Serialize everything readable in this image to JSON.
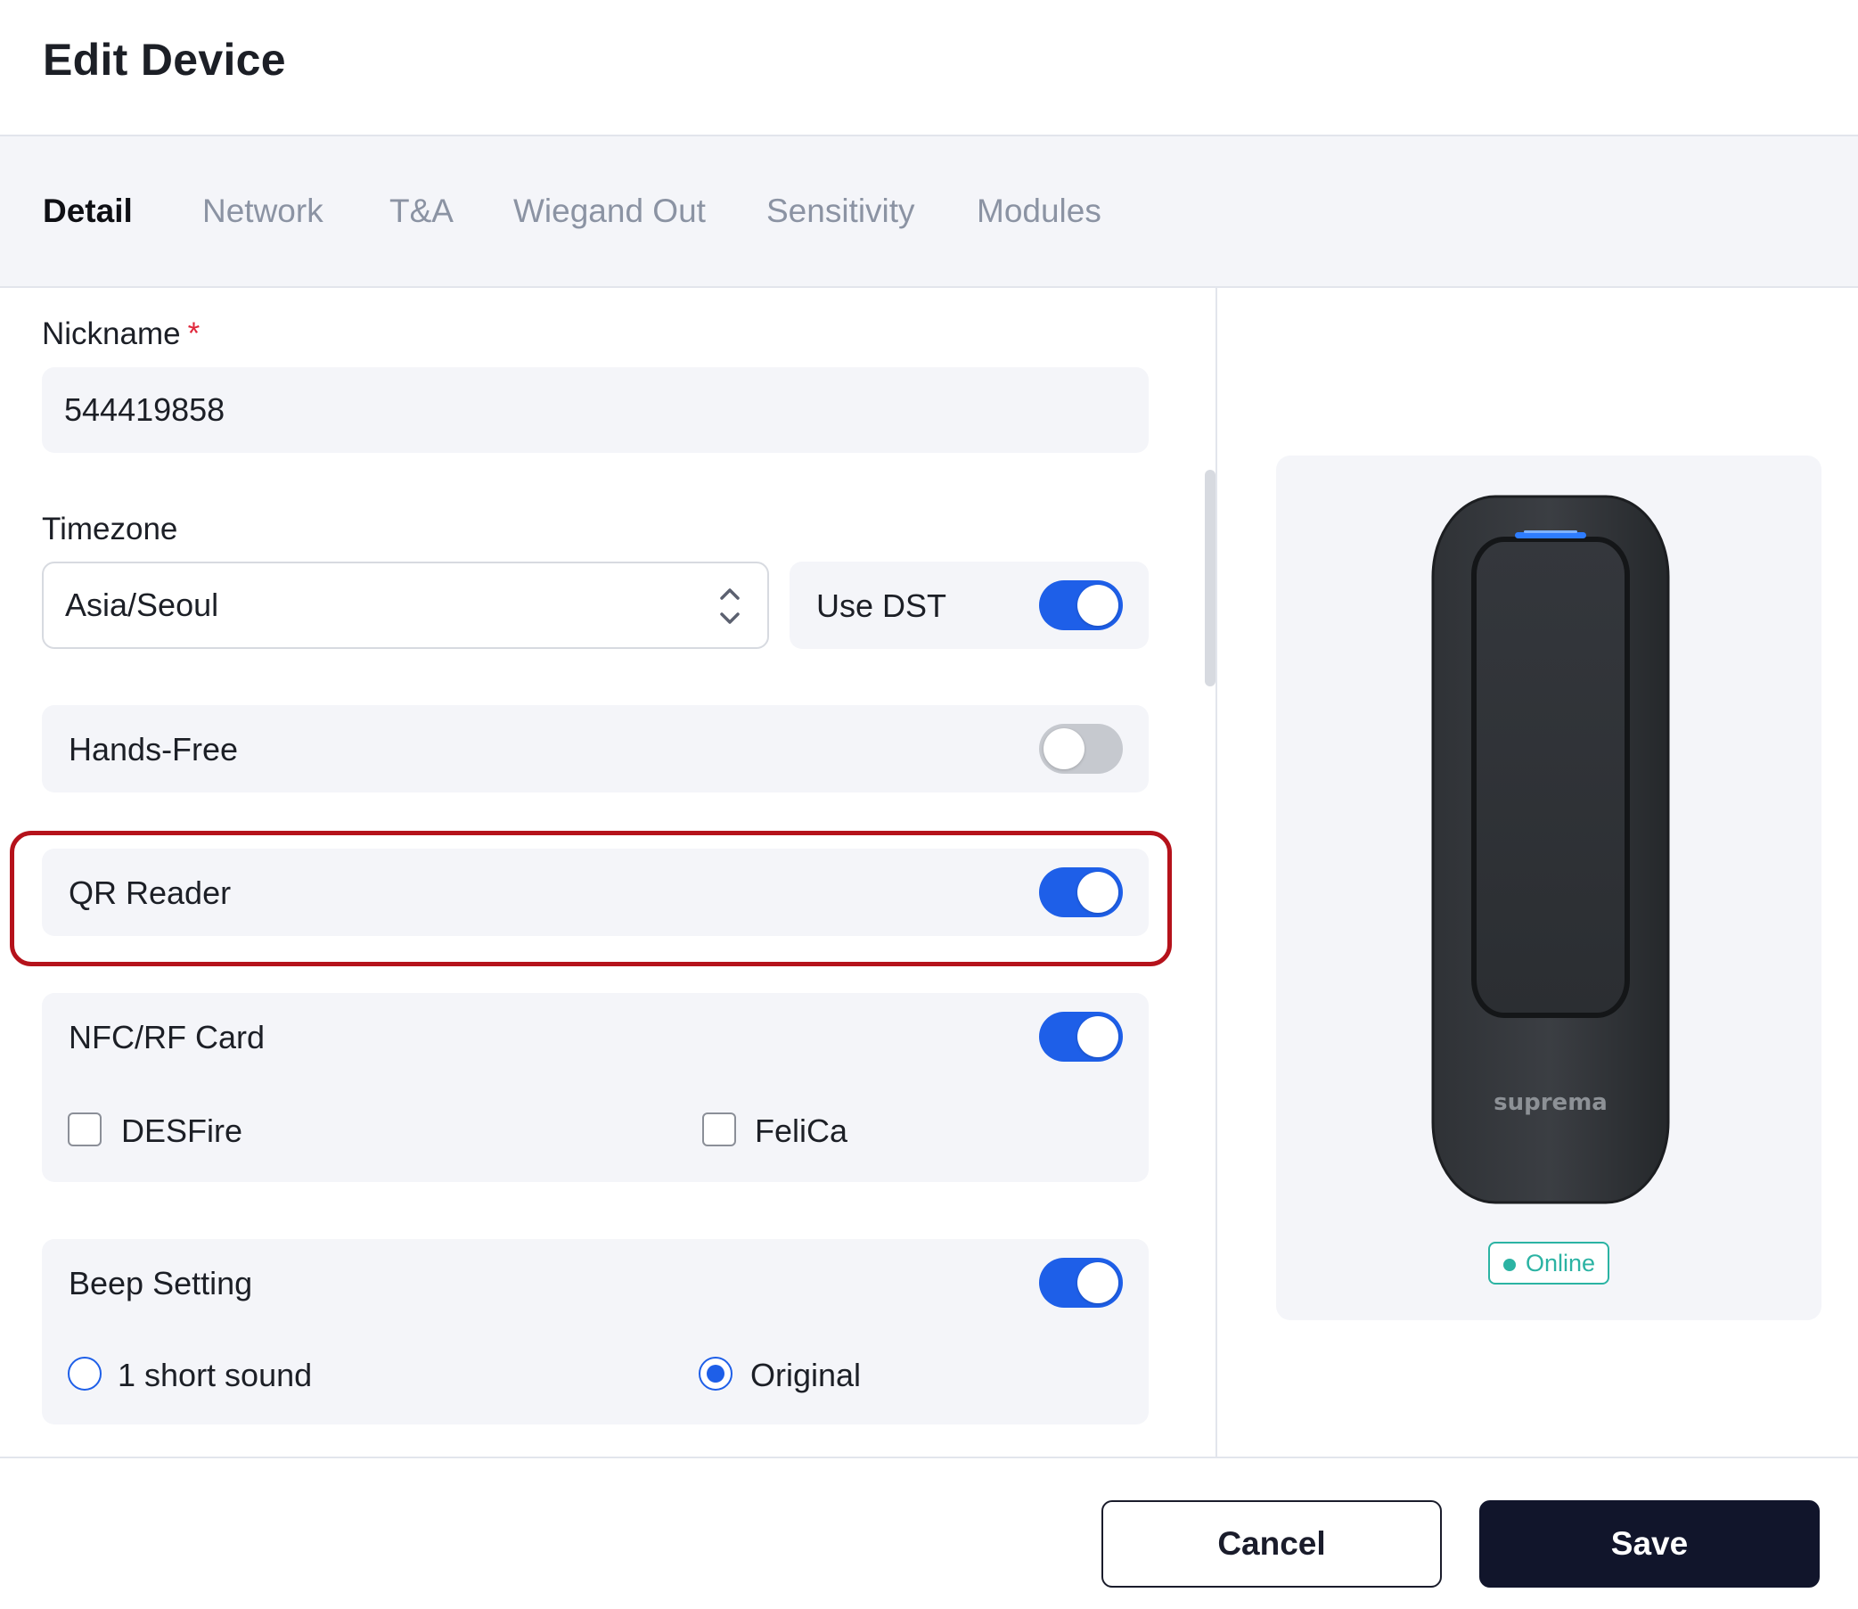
{
  "dialog": {
    "title": "Edit Device"
  },
  "tabs": [
    {
      "label": "Detail",
      "active": true
    },
    {
      "label": "Network",
      "active": false
    },
    {
      "label": "T&A",
      "active": false
    },
    {
      "label": "Wiegand Out",
      "active": false
    },
    {
      "label": "Sensitivity",
      "active": false
    },
    {
      "label": "Modules",
      "active": false
    }
  ],
  "nickname": {
    "label": "Nickname",
    "required_mark": "*",
    "value": "544419858"
  },
  "timezone": {
    "label": "Timezone",
    "value": "Asia/Seoul",
    "icon": "chevron-updown-icon"
  },
  "use_dst": {
    "label": "Use DST",
    "on": true
  },
  "hands_free": {
    "label": "Hands-Free",
    "on": false
  },
  "qr_reader": {
    "label": "QR Reader",
    "on": true,
    "highlighted": true
  },
  "nfc": {
    "label": "NFC/RF Card",
    "on": true,
    "options": [
      {
        "label": "DESFire",
        "checked": false
      },
      {
        "label": "FeliCa",
        "checked": false
      }
    ]
  },
  "beep": {
    "label": "Beep Setting",
    "on": true,
    "options": [
      {
        "label": "1 short sound",
        "selected": false
      },
      {
        "label": "Original",
        "selected": true
      }
    ]
  },
  "preview": {
    "brand": "suprema",
    "status": "Online"
  },
  "footer": {
    "cancel_label": "Cancel",
    "save_label": "Save"
  },
  "colors": {
    "accent": "#1e5fe8",
    "highlight_border": "#b5121b",
    "online": "#2bb3a3",
    "save_button": "#11152b",
    "panel_bg": "#f4f5f9"
  }
}
